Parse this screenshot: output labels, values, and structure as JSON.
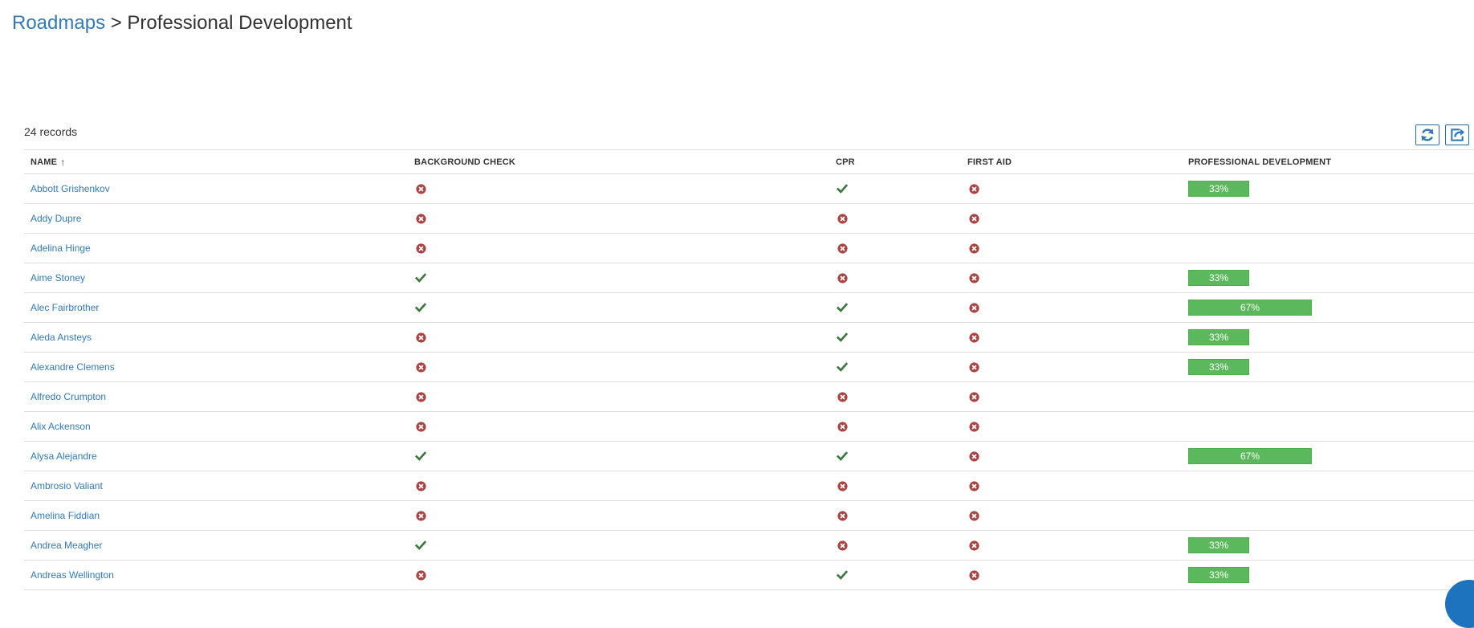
{
  "breadcrumb": {
    "root": "Roadmaps",
    "separator": " > ",
    "current": "Professional Development"
  },
  "records_label": "24 records",
  "toolbar": {
    "refresh_icon": "refresh-icon",
    "export_icon": "share-export-icon"
  },
  "columns": {
    "name": "NAME",
    "name_sort_icon": "↑",
    "background_check": "BACKGROUND CHECK",
    "cpr": "CPR",
    "first_aid": "FIRST AID",
    "professional_development": "PROFESSIONAL DEVELOPMENT"
  },
  "status_colors": {
    "complete": "#3c763d",
    "incomplete": "#a94442",
    "progress": "#5cb85c"
  },
  "rows": [
    {
      "name": "Abbott Grishenkov",
      "background_check": false,
      "cpr": true,
      "first_aid": false,
      "progress": 33,
      "progress_label": "33%"
    },
    {
      "name": "Addy Dupre",
      "background_check": false,
      "cpr": false,
      "first_aid": false,
      "progress": null,
      "progress_label": ""
    },
    {
      "name": "Adelina Hinge",
      "background_check": false,
      "cpr": false,
      "first_aid": false,
      "progress": null,
      "progress_label": ""
    },
    {
      "name": "Aime Stoney",
      "background_check": true,
      "cpr": false,
      "first_aid": false,
      "progress": 33,
      "progress_label": "33%"
    },
    {
      "name": "Alec Fairbrother",
      "background_check": true,
      "cpr": true,
      "first_aid": false,
      "progress": 67,
      "progress_label": "67%"
    },
    {
      "name": "Aleda Ansteys",
      "background_check": false,
      "cpr": true,
      "first_aid": false,
      "progress": 33,
      "progress_label": "33%"
    },
    {
      "name": "Alexandre Clemens",
      "background_check": false,
      "cpr": true,
      "first_aid": false,
      "progress": 33,
      "progress_label": "33%"
    },
    {
      "name": "Alfredo Crumpton",
      "background_check": false,
      "cpr": false,
      "first_aid": false,
      "progress": null,
      "progress_label": ""
    },
    {
      "name": "Alix Ackenson",
      "background_check": false,
      "cpr": false,
      "first_aid": false,
      "progress": null,
      "progress_label": ""
    },
    {
      "name": "Alysa Alejandre",
      "background_check": true,
      "cpr": true,
      "first_aid": false,
      "progress": 67,
      "progress_label": "67%"
    },
    {
      "name": "Ambrosio Valiant",
      "background_check": false,
      "cpr": false,
      "first_aid": false,
      "progress": null,
      "progress_label": ""
    },
    {
      "name": "Amelina Fiddian",
      "background_check": false,
      "cpr": false,
      "first_aid": false,
      "progress": null,
      "progress_label": ""
    },
    {
      "name": "Andrea Meagher",
      "background_check": true,
      "cpr": false,
      "first_aid": false,
      "progress": 33,
      "progress_label": "33%"
    },
    {
      "name": "Andreas Wellington",
      "background_check": false,
      "cpr": true,
      "first_aid": false,
      "progress": 33,
      "progress_label": "33%"
    }
  ]
}
